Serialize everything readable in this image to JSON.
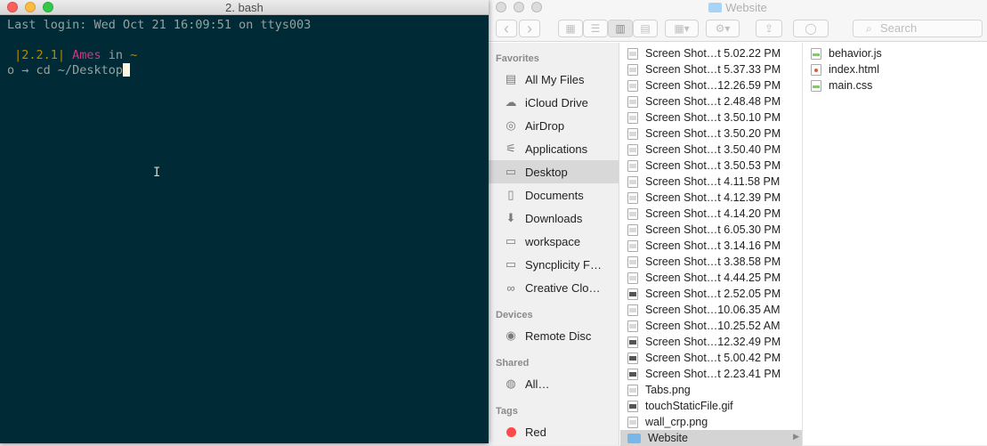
{
  "desktop": {
    "fragment": "Desktop file list"
  },
  "terminal": {
    "title": "2. bash",
    "lines": {
      "login": "Last login: Wed Oct 21 16:09:51 on ttys003",
      "prompt_version": " |2.2.1|",
      "prompt_user": " Ames",
      "prompt_in": " in",
      "prompt_dir": " ~",
      "command_prefix": "o → ",
      "command": "cd ~/Desktop"
    },
    "colors": {
      "background": "#002b36",
      "text": "#93a1a1",
      "version": "#b58900",
      "user": "#d33682"
    }
  },
  "finder": {
    "title": "Website",
    "search_placeholder": "Search",
    "toolbar": {
      "back": "‹",
      "forward": "›"
    },
    "sidebar": {
      "favorites_heading": "Favorites",
      "favorites": [
        {
          "label": "All My Files",
          "icon": "all-files-icon"
        },
        {
          "label": "iCloud Drive",
          "icon": "cloud-icon"
        },
        {
          "label": "AirDrop",
          "icon": "airdrop-icon"
        },
        {
          "label": "Applications",
          "icon": "applications-icon"
        },
        {
          "label": "Desktop",
          "icon": "desktop-icon",
          "selected": true
        },
        {
          "label": "Documents",
          "icon": "documents-icon"
        },
        {
          "label": "Downloads",
          "icon": "downloads-icon"
        },
        {
          "label": "workspace",
          "icon": "folder-icon"
        },
        {
          "label": "Syncplicity F…",
          "icon": "folder-icon"
        },
        {
          "label": "Creative Clo…",
          "icon": "creative-cloud-icon"
        }
      ],
      "devices_heading": "Devices",
      "devices": [
        {
          "label": "Remote Disc",
          "icon": "disc-icon"
        }
      ],
      "shared_heading": "Shared",
      "shared": [
        {
          "label": "All…",
          "icon": "network-icon"
        }
      ],
      "tags_heading": "Tags",
      "tags": [
        {
          "label": "Red",
          "color": "#fc4a4a"
        }
      ]
    },
    "desktop_files": [
      {
        "name": "Screen Shot…t 5.02.22 PM",
        "icon": "image-file-icon"
      },
      {
        "name": "Screen Shot…t 5.37.33 PM",
        "icon": "image-file-icon"
      },
      {
        "name": "Screen Shot…12.26.59 PM",
        "icon": "image-file-icon"
      },
      {
        "name": "Screen Shot…t 2.48.48 PM",
        "icon": "image-file-icon"
      },
      {
        "name": "Screen Shot…t 3.50.10 PM",
        "icon": "image-file-icon"
      },
      {
        "name": "Screen Shot…t 3.50.20 PM",
        "icon": "image-file-icon"
      },
      {
        "name": "Screen Shot…t 3.50.40 PM",
        "icon": "image-file-icon"
      },
      {
        "name": "Screen Shot…t 3.50.53 PM",
        "icon": "image-file-icon"
      },
      {
        "name": "Screen Shot…t 4.11.58 PM",
        "icon": "image-file-icon"
      },
      {
        "name": "Screen Shot…t 4.12.39 PM",
        "icon": "image-file-icon"
      },
      {
        "name": "Screen Shot…t 4.14.20 PM",
        "icon": "image-file-icon"
      },
      {
        "name": "Screen Shot…t 6.05.30 PM",
        "icon": "image-file-icon"
      },
      {
        "name": "Screen Shot…t 3.14.16 PM",
        "icon": "image-file-icon"
      },
      {
        "name": "Screen Shot…t 3.38.58 PM",
        "icon": "image-file-icon"
      },
      {
        "name": "Screen Shot…t 4.44.25 PM",
        "icon": "image-file-icon"
      },
      {
        "name": "Screen Shot…t 2.52.05 PM",
        "icon": "dark-image-file-icon"
      },
      {
        "name": "Screen Shot…10.06.35 AM",
        "icon": "image-file-icon"
      },
      {
        "name": "Screen Shot…10.25.52 AM",
        "icon": "image-file-icon"
      },
      {
        "name": "Screen Shot…12.32.49 PM",
        "icon": "dark-image-file-icon"
      },
      {
        "name": "Screen Shot…t 5.00.42 PM",
        "icon": "dark-image-file-icon"
      },
      {
        "name": "Screen Shot…t 2.23.41 PM",
        "icon": "dark-image-file-icon"
      },
      {
        "name": "Tabs.png",
        "icon": "image-file-icon"
      },
      {
        "name": "touchStaticFile.gif",
        "icon": "dark-image-file-icon"
      },
      {
        "name": "wall_crp.png",
        "icon": "image-file-icon"
      },
      {
        "name": "Website",
        "icon": "folder-icon",
        "selected": true
      }
    ],
    "website_files": [
      {
        "name": "behavior.js",
        "icon": "js-file-icon"
      },
      {
        "name": "index.html",
        "icon": "html-file-icon"
      },
      {
        "name": "main.css",
        "icon": "css-file-icon"
      }
    ]
  }
}
